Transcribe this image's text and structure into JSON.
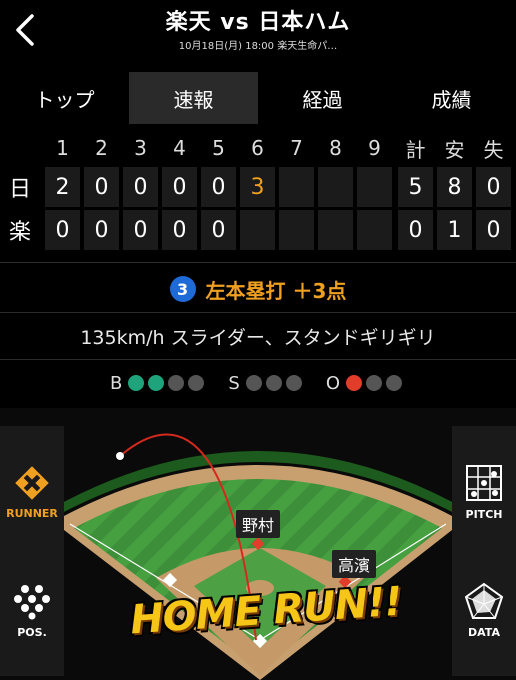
{
  "header": {
    "title": "楽天 vs 日本ハム",
    "subtitle": "10月18日(月) 18:00 楽天生命パ…"
  },
  "tabs": [
    {
      "label": "トップ",
      "active": false
    },
    {
      "label": "速報",
      "active": true
    },
    {
      "label": "経過",
      "active": false
    },
    {
      "label": "成績",
      "active": false
    }
  ],
  "scoreboard": {
    "columns": [
      "1",
      "2",
      "3",
      "4",
      "5",
      "6",
      "7",
      "8",
      "9",
      "計",
      "安",
      "失"
    ],
    "rows": [
      {
        "team": "日",
        "cells": [
          "2",
          "0",
          "0",
          "0",
          "0",
          "3",
          "",
          "",
          "",
          "5",
          "8",
          "0"
        ]
      },
      {
        "team": "楽",
        "cells": [
          "0",
          "0",
          "0",
          "0",
          "0",
          "",
          "",
          "",
          "",
          "0",
          "1",
          "0"
        ]
      }
    ]
  },
  "play": {
    "batter_number": "3",
    "result": "左本塁打 ＋3点"
  },
  "pitch": {
    "description": "135km/h スライダー、スタンドギリギリ"
  },
  "count": {
    "ball_label": "B",
    "strike_label": "S",
    "out_label": "O",
    "balls": 2,
    "strikes": 0,
    "outs": 1
  },
  "field": {
    "runner_label": "RUNNER",
    "pos_label": "POS.",
    "pitch_label": "PITCH",
    "data_label": "DATA",
    "fielder_1": "野村",
    "fielder_2": "高濱",
    "banner": "HOME RUN!!"
  },
  "colors": {
    "accent": "#f0a020",
    "ball": "#1fa37a",
    "out": "#e23c2a",
    "badge": "#1e6ad6"
  }
}
